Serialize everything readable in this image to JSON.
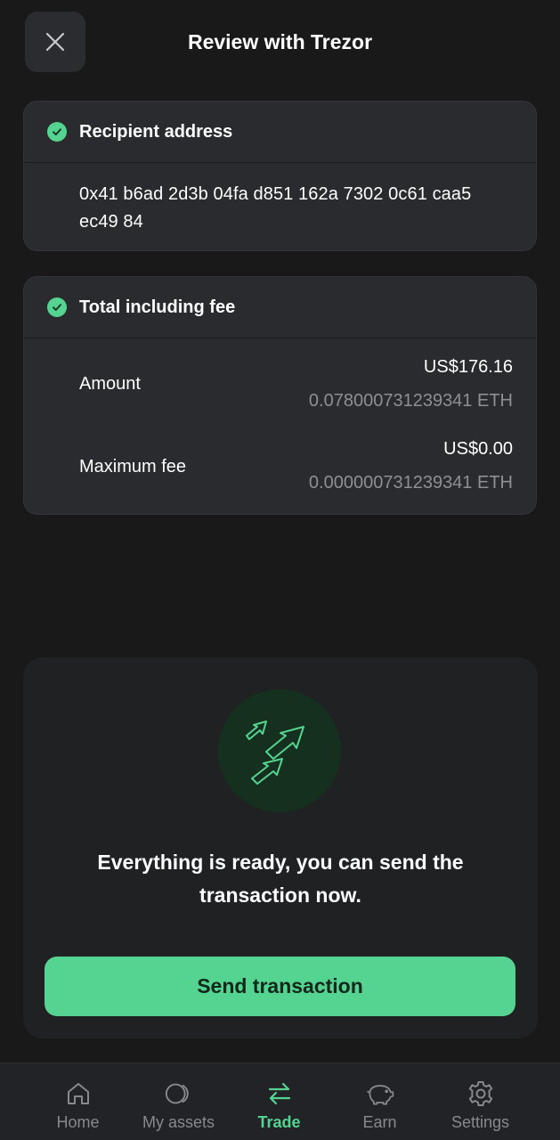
{
  "header": {
    "title": "Review with Trezor",
    "close_icon": "close-icon"
  },
  "recipient": {
    "title": "Recipient address",
    "address": "0x41 b6ad 2d3b 04fa d851 162a 7302 0c61 caa5 ec49 84"
  },
  "total": {
    "title": "Total including fee",
    "rows": [
      {
        "label": "Amount",
        "fiat": "US$176.16",
        "crypto": "0.078000731239341 ETH"
      },
      {
        "label": "Maximum fee",
        "fiat": "US$0.00",
        "crypto": "0.000000731239341 ETH"
      }
    ]
  },
  "ready": {
    "icon": "send-arrows-icon",
    "message": "Everything is ready, you can send the transaction now.",
    "button_label": "Send transaction"
  },
  "nav": {
    "items": [
      {
        "label": "Home",
        "icon": "home-icon",
        "active": false
      },
      {
        "label": "My assets",
        "icon": "assets-icon",
        "active": false
      },
      {
        "label": "Trade",
        "icon": "trade-icon",
        "active": true
      },
      {
        "label": "Earn",
        "icon": "piggy-bank-icon",
        "active": false
      },
      {
        "label": "Settings",
        "icon": "gear-icon",
        "active": false
      }
    ]
  },
  "colors": {
    "background": "#19191a",
    "card": "#2a2b2e",
    "accent": "#55d391",
    "muted_text": "#8e8f93"
  }
}
